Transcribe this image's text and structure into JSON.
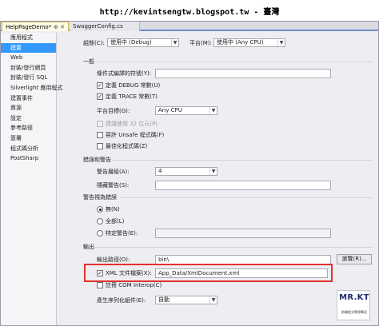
{
  "banner": "http://kevintsengtw.blogspot.tw - 臺灣",
  "tabs": [
    {
      "label": "HelpPageDemo*",
      "pin": "⊕ ✕"
    },
    {
      "label": "SwaggerConfig.cs"
    }
  ],
  "sidebar": {
    "items": [
      {
        "label": "應用程式",
        "selected": false
      },
      {
        "label": "建置",
        "selected": true
      },
      {
        "label": "Web",
        "selected": false
      },
      {
        "label": "封裝/發行網頁",
        "selected": false
      },
      {
        "label": "封裝/發行 SQL",
        "selected": false
      },
      {
        "label": "Silverlight 應用程式",
        "selected": false
      },
      {
        "label": "建置事件",
        "selected": false
      },
      {
        "label": "資源",
        "selected": false
      },
      {
        "label": "設定",
        "selected": false
      },
      {
        "label": "參考路徑",
        "selected": false
      },
      {
        "label": "簽署",
        "selected": false
      },
      {
        "label": "程式碼分析",
        "selected": false
      },
      {
        "label": "PostSharp",
        "selected": false
      }
    ]
  },
  "config": {
    "label": "組態(C):",
    "value": "使用中 (Debug)"
  },
  "platform": {
    "label": "平台(M):",
    "value": "使用中 (Any CPU)"
  },
  "general": {
    "title": "一般",
    "conditional_symbols_label": "條件式編譯的符號(Y):",
    "conditional_symbols_value": "",
    "define_debug": {
      "label": "定義 DEBUG 常數(U)",
      "checked": true
    },
    "define_trace": {
      "label": "定義 TRACE 常數(T)",
      "checked": true
    },
    "platform_target": {
      "label": "平台目標(G):",
      "value": "Any CPU"
    },
    "prefer_32bit": {
      "label": "建議使用 32 位元(P)",
      "checked": false,
      "disabled": true
    },
    "allow_unsafe": {
      "label": "容許 Unsafe 程式碼(F)",
      "checked": false
    },
    "optimize": {
      "label": "最佳化程式碼(Z)",
      "checked": false
    }
  },
  "errors": {
    "title": "錯誤和警告",
    "warning_level": {
      "label": "警告層級(A):",
      "value": "4"
    },
    "suppress": {
      "label": "隱藏警告(S):",
      "value": ""
    }
  },
  "treat_warnings": {
    "title": "警告視為錯誤",
    "options": [
      {
        "label": "無(N)",
        "selected": true
      },
      {
        "label": "全部(L)",
        "selected": false
      },
      {
        "label": "特定警告(E):",
        "selected": false
      }
    ],
    "specific_value": ""
  },
  "output": {
    "title": "輸出",
    "output_path": {
      "label": "輸出路徑(O):",
      "value": "bin\\"
    },
    "browse_label": "瀏覽(R)...",
    "xml_doc": {
      "label": "XML 文件檔案(X):",
      "value": "App_Data/XmlDocument.xml",
      "checked": true
    },
    "com_interop": {
      "label": "註冊 COM Interop(C)",
      "checked": false
    },
    "serialization": {
      "label": "產生序列化組件(E):",
      "value": "自動"
    }
  },
  "logo": {
    "title": "MR.KT",
    "subtitle": "前端程式學習筆記"
  }
}
